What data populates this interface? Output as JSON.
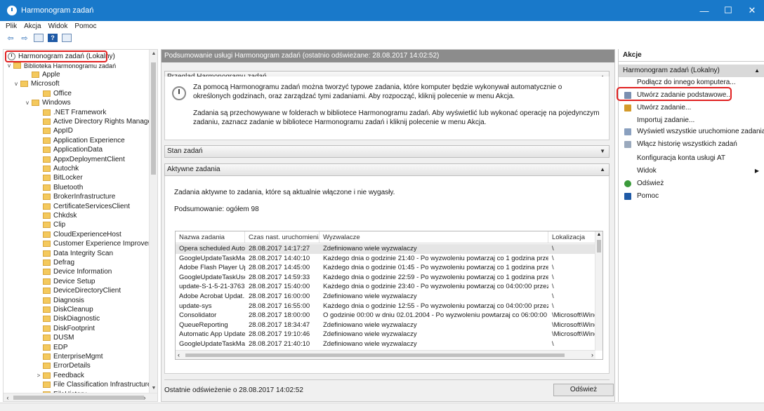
{
  "window": {
    "title": "Harmonogram zadań",
    "controls": [
      "—",
      "☐",
      "✕"
    ]
  },
  "menu": [
    "Plik",
    "Akcja",
    "Widok",
    "Pomoc"
  ],
  "toolbar": {
    "icons": [
      "back-arrow-icon",
      "forward-arrow-icon",
      "show-hide-console-tree-icon",
      "help-icon",
      "show-hide-action-pane-icon"
    ],
    "help_glyph": "?"
  },
  "tree": {
    "root": "Harmonogram zadań (Lokalny)",
    "library": "Biblioteka Harmonogramu zadań",
    "items": [
      {
        "label": "Apple",
        "level": 2,
        "caret": ""
      },
      {
        "label": "Microsoft",
        "level": 1,
        "caret": "v"
      },
      {
        "label": "Office",
        "level": 3,
        "caret": ""
      },
      {
        "label": "Windows",
        "level": 2,
        "caret": "v"
      },
      {
        "label": ".NET Framework",
        "level": 3,
        "caret": ""
      },
      {
        "label": "Active Directory Rights Manager",
        "level": 3,
        "caret": ""
      },
      {
        "label": "AppID",
        "level": 3,
        "caret": ""
      },
      {
        "label": "Application Experience",
        "level": 3,
        "caret": ""
      },
      {
        "label": "ApplicationData",
        "level": 3,
        "caret": ""
      },
      {
        "label": "AppxDeploymentClient",
        "level": 3,
        "caret": ""
      },
      {
        "label": "Autochk",
        "level": 3,
        "caret": ""
      },
      {
        "label": "BitLocker",
        "level": 3,
        "caret": ""
      },
      {
        "label": "Bluetooth",
        "level": 3,
        "caret": ""
      },
      {
        "label": "BrokerInfrastructure",
        "level": 3,
        "caret": ""
      },
      {
        "label": "CertificateServicesClient",
        "level": 3,
        "caret": ""
      },
      {
        "label": "Chkdsk",
        "level": 3,
        "caret": ""
      },
      {
        "label": "Clip",
        "level": 3,
        "caret": ""
      },
      {
        "label": "CloudExperienceHost",
        "level": 3,
        "caret": ""
      },
      {
        "label": "Customer Experience Improvem",
        "level": 3,
        "caret": ""
      },
      {
        "label": "Data Integrity Scan",
        "level": 3,
        "caret": ""
      },
      {
        "label": "Defrag",
        "level": 3,
        "caret": ""
      },
      {
        "label": "Device Information",
        "level": 3,
        "caret": ""
      },
      {
        "label": "Device Setup",
        "level": 3,
        "caret": ""
      },
      {
        "label": "DeviceDirectoryClient",
        "level": 3,
        "caret": ""
      },
      {
        "label": "Diagnosis",
        "level": 3,
        "caret": ""
      },
      {
        "label": "DiskCleanup",
        "level": 3,
        "caret": ""
      },
      {
        "label": "DiskDiagnostic",
        "level": 3,
        "caret": ""
      },
      {
        "label": "DiskFootprint",
        "level": 3,
        "caret": ""
      },
      {
        "label": "DUSM",
        "level": 3,
        "caret": ""
      },
      {
        "label": "EDP",
        "level": 3,
        "caret": ""
      },
      {
        "label": "EnterpriseMgmt",
        "level": 3,
        "caret": ""
      },
      {
        "label": "ErrorDetails",
        "level": 3,
        "caret": ""
      },
      {
        "label": "Feedback",
        "level": 3,
        "caret": ">"
      },
      {
        "label": "File Classification Infrastructure",
        "level": 3,
        "caret": ""
      },
      {
        "label": "FileHistory",
        "level": 3,
        "caret": ""
      }
    ]
  },
  "center": {
    "header": "Podsumowanie usługi Harmonogram zadań (ostatnio odświeżane: 28.08.2017 14:02:52)",
    "overview_title": "Przegląd Harmonogramu zadań",
    "overview_p1": "Za pomocą Harmonogramu zadań można tworzyć typowe zadania, które komputer będzie wykonywał automatycznie o określonych godzinach, oraz zarządzać tymi zadaniami. Aby rozpocząć, kliknij polecenie w menu Akcja.",
    "overview_p2": "Zadania są przechowywane w folderach w bibliotece Harmonogramu zadań. Aby wyświetlić lub wykonać operację na pojedynczym zadaniu, zaznacz zadanie w bibliotece Harmonogramu zadań i kliknij polecenie w menu Akcja.",
    "status_title": "Stan zadań",
    "active_title": "Aktywne zadania",
    "active_desc": "Zadania aktywne to zadania, które są aktualnie włączone i nie wygasły.",
    "summary": "Podsumowanie: ogółem 98",
    "columns": [
      "Nazwa zadania",
      "Czas nast. uruchomienia",
      "Wyzwalacze",
      "Lokalizacja"
    ],
    "rows": [
      [
        "Opera scheduled Auto...",
        "28.08.2017 14:17:27",
        "Zdefiniowano wiele wyzwalaczy",
        "\\"
      ],
      [
        "GoogleUpdateTaskMa...",
        "28.08.2017 14:40:10",
        "Każdego dnia o godzinie 21:40 - Po wyzwoleniu powtarzaj co 1 godzina przez okr...",
        "\\"
      ],
      [
        "Adobe Flash Player Up...",
        "28.08.2017 14:45:00",
        "Każdego dnia o godzinie 01:45 - Po wyzwoleniu powtarzaj co 1 godzina przez okr...",
        "\\"
      ],
      [
        "GoogleUpdateTaskUse...",
        "28.08.2017 14:59:33",
        "Każdego dnia o godzinie 22:59 - Po wyzwoleniu powtarzaj co 1 godzina przez okr...",
        "\\"
      ],
      [
        "update-S-1-5-21-3763...",
        "28.08.2017 15:40:00",
        "Każdego dnia o godzinie 23:40 - Po wyzwoleniu powtarzaj co 04:00:00 przez okre...",
        "\\"
      ],
      [
        "Adobe Acrobat Updat...",
        "28.08.2017 16:00:00",
        "Zdefiniowano wiele wyzwalaczy",
        "\\"
      ],
      [
        "update-sys",
        "28.08.2017 16:55:00",
        "Każdego dnia o godzinie 12:55 - Po wyzwoleniu powtarzaj co 04:00:00 przez okre...",
        "\\"
      ],
      [
        "Consolidator",
        "28.08.2017 18:00:00",
        "O godzinie 00:00 w dniu 02.01.2004 - Po wyzwoleniu powtarzaj co 06:00:00 przez ...",
        "\\Microsoft\\Windo"
      ],
      [
        "QueueReporting",
        "28.08.2017 18:34:47",
        "Zdefiniowano wiele wyzwalaczy",
        "\\Microsoft\\Windo"
      ],
      [
        "Automatic App Update",
        "28.08.2017 19:10:46",
        "Zdefiniowano wiele wyzwalaczy",
        "\\Microsoft\\Windo"
      ],
      [
        "GoogleUpdateTaskMa...",
        "28.08.2017 21:40:10",
        "Zdefiniowano wiele wyzwalaczy",
        "\\"
      ]
    ],
    "last_refresh": "Ostatnie odświeżenie o 28.08.2017 14:02:52",
    "refresh_button": "Odśwież"
  },
  "actions": {
    "title": "Akcje",
    "group": "Harmonogram zadań (Lokalny)",
    "items": [
      {
        "label": "Podłącz do innego komputera...",
        "icon": "",
        "submenu": false
      },
      {
        "label": "Utwórz zadanie podstawowe...",
        "icon": "create-basic-task-icon",
        "submenu": false
      },
      {
        "label": "Utwórz zadanie...",
        "icon": "create-task-icon",
        "submenu": false
      },
      {
        "label": "Importuj zadanie...",
        "icon": "",
        "submenu": false
      },
      {
        "label": "Wyświetl wszystkie uruchomione zadania",
        "icon": "running-tasks-icon",
        "submenu": false
      },
      {
        "label": "Włącz historię wszystkich zadań",
        "icon": "history-icon",
        "submenu": false
      },
      {
        "label": "Konfiguracja konta usługi AT",
        "icon": "",
        "submenu": false
      },
      {
        "label": "Widok",
        "icon": "",
        "submenu": true
      },
      {
        "label": "Odśwież",
        "icon": "refresh-icon",
        "submenu": false
      },
      {
        "label": "Pomoc",
        "icon": "help-icon",
        "submenu": false
      }
    ]
  },
  "colors": {
    "titlebar": "#1979ca",
    "highlight_box": "#e02020",
    "folder": "#f4c95d",
    "header_gray": "#8c8c8c"
  }
}
